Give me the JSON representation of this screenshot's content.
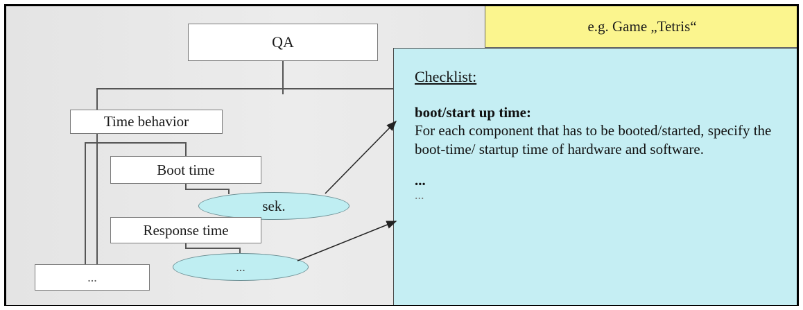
{
  "tree": {
    "root": "QA",
    "category": "Time behavior",
    "sub1": "Boot time",
    "sub1_unit": "sek.",
    "sub2": "Response time",
    "sub2_unit": "...",
    "more": "..."
  },
  "example": "e.g. Game „Tetris“",
  "checklist": {
    "title": "Checklist:",
    "heading": "boot/start up time:",
    "body": "For each component that has to be booted/started, specify the boot-time/ startup time of hardware and software.",
    "dots_bold": "...",
    "dots_light": "..."
  }
}
